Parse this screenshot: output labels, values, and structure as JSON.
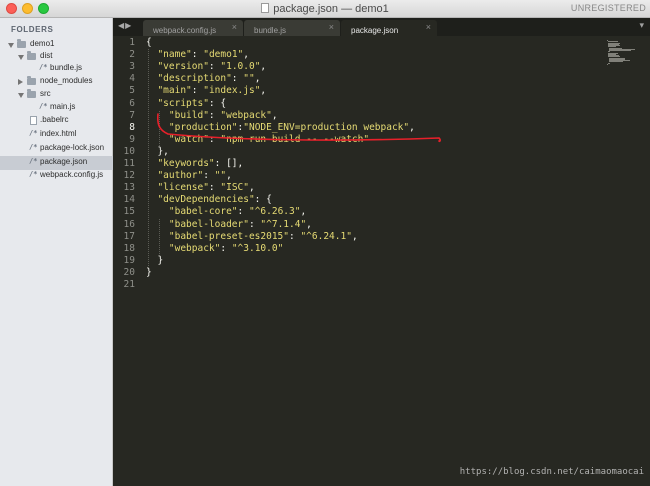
{
  "window": {
    "title": "package.json — demo1",
    "unregistered_label": "UNREGISTERED"
  },
  "sidebar": {
    "header": "FOLDERS",
    "items": [
      {
        "label": "demo1",
        "kind": "folder",
        "state": "open",
        "depth": 0
      },
      {
        "label": "dist",
        "kind": "folder",
        "state": "open",
        "depth": 1
      },
      {
        "label": "bundle.js",
        "kind": "code-file",
        "depth": 2
      },
      {
        "label": "node_modules",
        "kind": "folder",
        "state": "closed",
        "depth": 1
      },
      {
        "label": "src",
        "kind": "folder",
        "state": "open",
        "depth": 1
      },
      {
        "label": "main.js",
        "kind": "code-file",
        "depth": 2
      },
      {
        "label": ".babelrc",
        "kind": "file",
        "depth": 1
      },
      {
        "label": "index.html",
        "kind": "code-file",
        "depth": 1
      },
      {
        "label": "package-lock.json",
        "kind": "code-file",
        "depth": 1
      },
      {
        "label": "package.json",
        "kind": "code-file",
        "depth": 1,
        "selected": true
      },
      {
        "label": "webpack.config.js",
        "kind": "code-file",
        "depth": 1
      }
    ]
  },
  "tabs": [
    {
      "label": "webpack.config.js",
      "active": false
    },
    {
      "label": "bundle.js",
      "active": false
    },
    {
      "label": "package.json",
      "active": true
    }
  ],
  "tab_nav_icons": [
    "left-arrow-icon",
    "right-arrow-icon"
  ],
  "editor": {
    "lines": [
      [
        [
          "p",
          "{"
        ]
      ],
      [
        [
          "s",
          "  \"name\""
        ],
        [
          "p",
          ": "
        ],
        [
          "s",
          "\"demo1\""
        ],
        [
          "p",
          ","
        ]
      ],
      [
        [
          "s",
          "  \"version\""
        ],
        [
          "p",
          ": "
        ],
        [
          "s",
          "\"1.0.0\""
        ],
        [
          "p",
          ","
        ]
      ],
      [
        [
          "s",
          "  \"description\""
        ],
        [
          "p",
          ": "
        ],
        [
          "s",
          "\"\""
        ],
        [
          "p",
          ","
        ]
      ],
      [
        [
          "s",
          "  \"main\""
        ],
        [
          "p",
          ": "
        ],
        [
          "s",
          "\"index.js\""
        ],
        [
          "p",
          ","
        ]
      ],
      [
        [
          "s",
          "  \"scripts\""
        ],
        [
          "p",
          ": {"
        ]
      ],
      [
        [
          "s",
          "    \"build\""
        ],
        [
          "p",
          ": "
        ],
        [
          "s",
          "\"webpack\""
        ],
        [
          "p",
          ","
        ]
      ],
      [
        [
          "s",
          "    \"production\""
        ],
        [
          "p",
          ":"
        ],
        [
          "s",
          "\"NODE_ENV=production webpack\""
        ],
        [
          "p",
          ","
        ]
      ],
      [
        [
          "s",
          "    \"watch\""
        ],
        [
          "p",
          ": "
        ],
        [
          "s",
          "\"npm run build -- --watch\""
        ]
      ],
      [
        [
          "p",
          "  },"
        ]
      ],
      [
        [
          "s",
          "  \"keywords\""
        ],
        [
          "p",
          ": [],"
        ]
      ],
      [
        [
          "s",
          "  \"author\""
        ],
        [
          "p",
          ": "
        ],
        [
          "s",
          "\"\""
        ],
        [
          "p",
          ","
        ]
      ],
      [
        [
          "s",
          "  \"license\""
        ],
        [
          "p",
          ": "
        ],
        [
          "s",
          "\"ISC\""
        ],
        [
          "p",
          ","
        ]
      ],
      [
        [
          "s",
          "  \"devDependencies\""
        ],
        [
          "p",
          ": {"
        ]
      ],
      [
        [
          "s",
          "    \"babel-core\""
        ],
        [
          "p",
          ": "
        ],
        [
          "s",
          "\"^6.26.3\""
        ],
        [
          "p",
          ","
        ]
      ],
      [
        [
          "s",
          "    \"babel-loader\""
        ],
        [
          "p",
          ": "
        ],
        [
          "s",
          "\"^7.1.4\""
        ],
        [
          "p",
          ","
        ]
      ],
      [
        [
          "s",
          "    \"babel-preset-es2015\""
        ],
        [
          "p",
          ": "
        ],
        [
          "s",
          "\"^6.24.1\""
        ],
        [
          "p",
          ","
        ]
      ],
      [
        [
          "s",
          "    \"webpack\""
        ],
        [
          "p",
          ": "
        ],
        [
          "s",
          "\"^3.10.0\""
        ]
      ],
      [
        [
          "p",
          "  }"
        ]
      ],
      [
        [
          "p",
          "}"
        ]
      ],
      [
        [
          "p",
          ""
        ]
      ]
    ],
    "current_line": 8,
    "highlighted_line": 8,
    "annotation_color": "#e8202a",
    "string_color": "#e6db74",
    "text_color": "#f8f8f2"
  },
  "watermark": "https://blog.csdn.net/caimaomaocai"
}
